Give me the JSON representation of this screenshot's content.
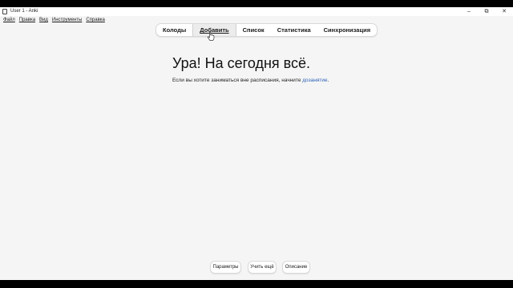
{
  "window": {
    "title": "User 1 - Anki",
    "controls": {
      "minimize": "–",
      "restore": "⧉",
      "close": "✕"
    }
  },
  "menu": {
    "items": [
      "Файл",
      "Правка",
      "Вид",
      "Инструменты",
      "Справка"
    ]
  },
  "toolbar": {
    "tabs": [
      "Колоды",
      "Добавить",
      "Список",
      "Статистика",
      "Синхронизация"
    ],
    "active_tab": "Добавить"
  },
  "main": {
    "headline": "Ура! На сегодня всё.",
    "subtext_before": "Если вы хотите заниматься вне расписания, начните ",
    "subtext_link": "дозанятие",
    "subtext_after": "."
  },
  "bottom": {
    "buttons": [
      "Параметры",
      "Учить ещё",
      "Описание"
    ]
  },
  "colors": {
    "background": "#f5f5f5",
    "link": "#2c62b8",
    "frame": "#000000"
  }
}
